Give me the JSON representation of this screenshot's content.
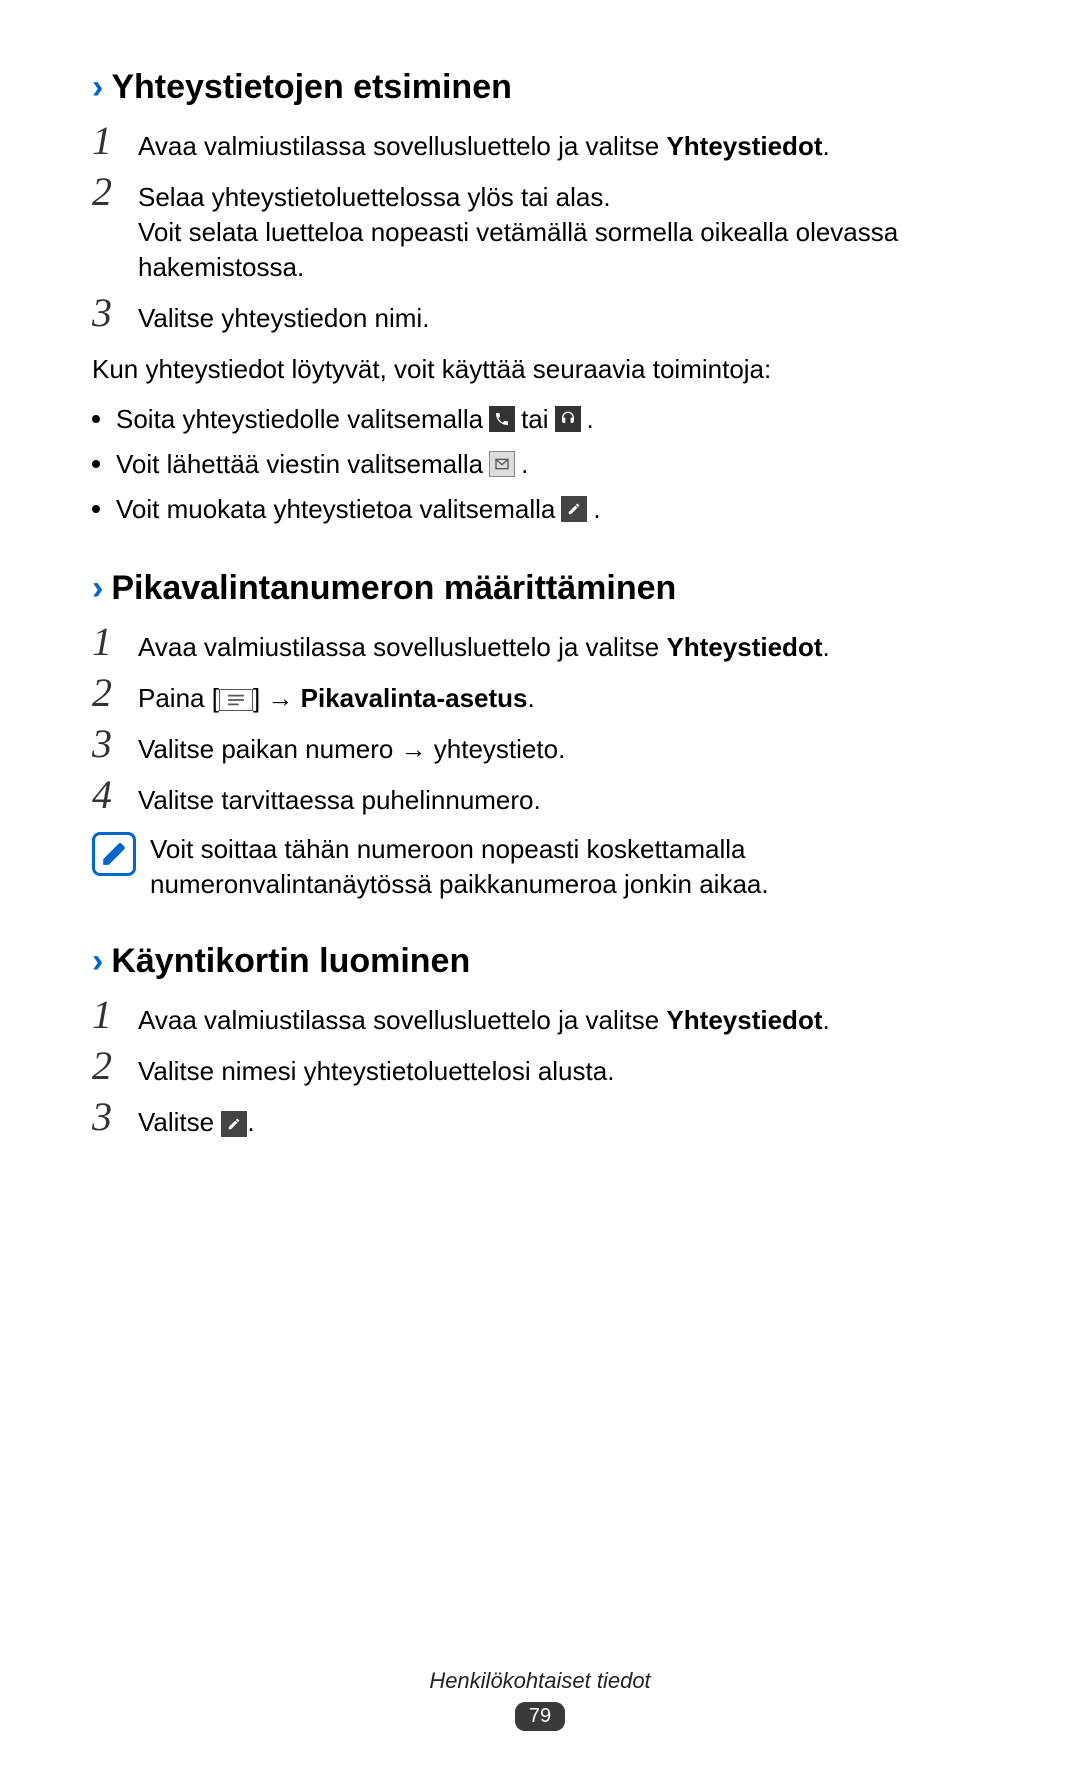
{
  "section1": {
    "heading": "Yhteystietojen etsiminen",
    "step1_pre": "Avaa valmiustilassa sovellusluettelo ja valitse ",
    "step1_bold": "Yhteystiedot",
    "step1_post": ".",
    "step2_line1": "Selaa yhteystietoluettelossa ylös tai alas.",
    "step2_line2": "Voit selata luetteloa nopeasti vetämällä sormella oikealla olevassa hakemistossa.",
    "step3": "Valitse yhteystiedon nimi.",
    "para": "Kun yhteystiedot löytyvät, voit käyttää seuraavia toimintoja:",
    "bullet1_pre": "Soita yhteystiedolle valitsemalla ",
    "bullet1_mid": " tai ",
    "bullet1_post": ".",
    "bullet2_pre": "Voit lähettää viestin valitsemalla ",
    "bullet2_post": ".",
    "bullet3_pre": "Voit muokata yhteystietoa valitsemalla ",
    "bullet3_post": "."
  },
  "section2": {
    "heading": "Pikavalintanumeron määrittäminen",
    "step1_pre": "Avaa valmiustilassa sovellusluettelo ja valitse ",
    "step1_bold": "Yhteystiedot",
    "step1_post": ".",
    "step2_pre": "Paina [",
    "step2_mid": "] → ",
    "step2_bold": "Pikavalinta-asetus",
    "step2_post": ".",
    "step3": "Valitse paikan numero → yhteystieto.",
    "step4": "Valitse tarvittaessa puhelinnumero.",
    "note": "Voit soittaa tähän numeroon nopeasti koskettamalla numeronvalintanäytössä paikkanumeroa jonkin aikaa."
  },
  "section3": {
    "heading": "Käyntikortin luominen",
    "step1_pre": "Avaa valmiustilassa sovellusluettelo ja valitse ",
    "step1_bold": "Yhteystiedot",
    "step1_post": ".",
    "step2": "Valitse nimesi yhteystietoluettelosi alusta.",
    "step3_pre": "Valitse ",
    "step3_post": "."
  },
  "footer": {
    "title": "Henkilökohtaiset tiedot",
    "page": "79"
  },
  "numbers": {
    "n1": "1",
    "n2": "2",
    "n3": "3",
    "n4": "4"
  }
}
